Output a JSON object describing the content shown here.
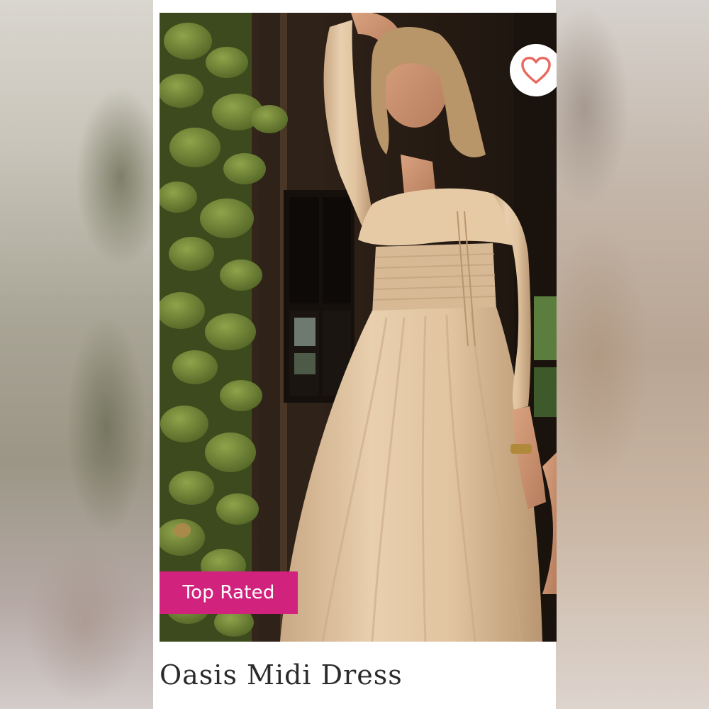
{
  "product": {
    "title": "Oasis Midi Dress",
    "badge": "Top Rated",
    "badge_color": "#d1237d",
    "image": {
      "subject": "model-in-beige-midi-dress",
      "icon": "product-photo"
    },
    "favorite": {
      "icon": "heart-icon",
      "color": "#e86a5f"
    }
  }
}
